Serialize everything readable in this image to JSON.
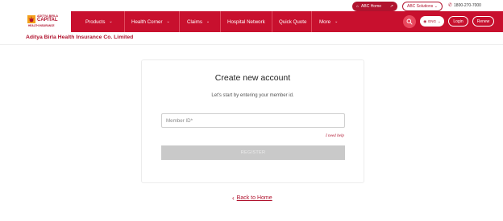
{
  "topbar": {
    "abc_home": "ABC Home",
    "abc_solutions": "ABC Solutions",
    "phone": "1800-270-7000"
  },
  "logo": {
    "line1": "ADITYA BIRLA",
    "line2": "CAPITAL",
    "line3": "HEALTH INSURANCE"
  },
  "nav": {
    "items": [
      {
        "label": "Products"
      },
      {
        "label": "Health Corner"
      },
      {
        "label": "Claims"
      },
      {
        "label": "Hospital Network"
      },
      {
        "label": "Quick Quote"
      },
      {
        "label": "More"
      }
    ],
    "lang": "ENG",
    "login": "Login",
    "renew": "Renew"
  },
  "company_name": "Aditya Birla Health Insurance Co. Limited",
  "card": {
    "title": "Create new account",
    "subtitle": "Let's start by entering your member id.",
    "member_id_placeholder": "Member ID*",
    "need_help": "I need help",
    "register": "REGISTER"
  },
  "back_link": "Back to Home",
  "colors": {
    "brand": "#c8102e",
    "brand_dark": "#b0132e",
    "disabled_button": "#c9c9c9"
  },
  "icons": {
    "home": "home-icon",
    "external": "external-link-icon",
    "phone": "phone-icon",
    "search": "search-icon",
    "chevron": "chevron-down-icon",
    "back": "chevron-left-icon"
  }
}
